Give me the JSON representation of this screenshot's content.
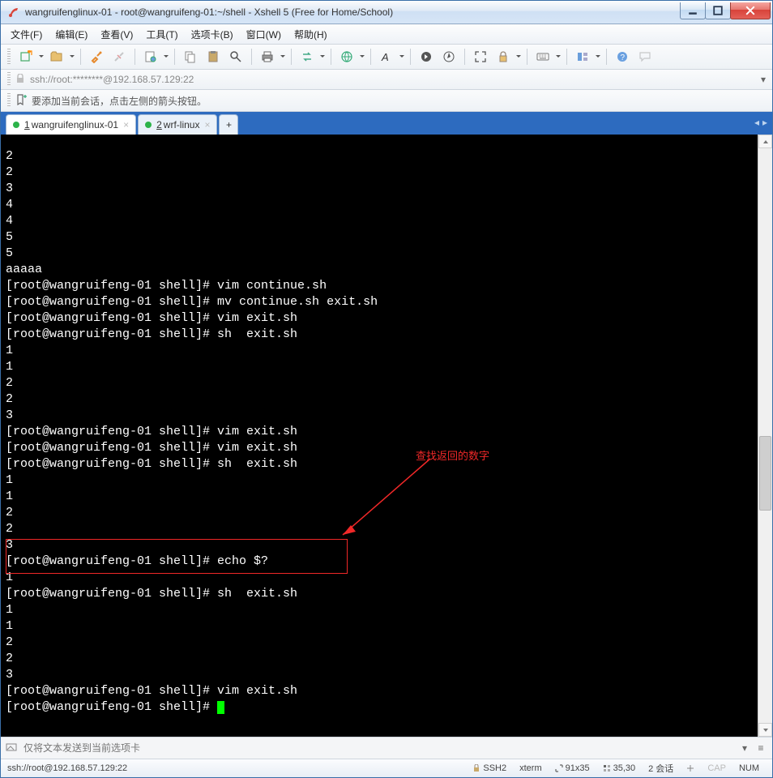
{
  "window_title": "wangruifenglinux-01 - root@wangruifeng-01:~/shell - Xshell 5 (Free for Home/School)",
  "menu": [
    "文件(F)",
    "编辑(E)",
    "查看(V)",
    "工具(T)",
    "选项卡(B)",
    "窗口(W)",
    "帮助(H)"
  ],
  "address": "ssh://root:********@192.168.57.129:22",
  "tip": "要添加当前会话，点击左侧的箭头按钮。",
  "tabs": [
    {
      "num": "1",
      "label": "wangruifenglinux-01",
      "dot": "#2db34a",
      "active": true
    },
    {
      "num": "2",
      "label": "wrf-linux",
      "dot": "#2db34a",
      "active": false
    }
  ],
  "terminal": {
    "lines": [
      "2",
      "2",
      "3",
      "4",
      "4",
      "5",
      "5",
      "aaaaa",
      "[root@wangruifeng-01 shell]# vim continue.sh",
      "[root@wangruifeng-01 shell]# mv continue.sh exit.sh",
      "[root@wangruifeng-01 shell]# vim exit.sh",
      "[root@wangruifeng-01 shell]# sh  exit.sh",
      "1",
      "1",
      "2",
      "2",
      "3",
      "[root@wangruifeng-01 shell]# vim exit.sh",
      "[root@wangruifeng-01 shell]# vim exit.sh",
      "[root@wangruifeng-01 shell]# sh  exit.sh",
      "1",
      "1",
      "2",
      "2",
      "3",
      "[root@wangruifeng-01 shell]# echo $?",
      "1",
      "[root@wangruifeng-01 shell]# sh  exit.sh",
      "1",
      "1",
      "2",
      "2",
      "3",
      "[root@wangruifeng-01 shell]# vim exit.sh",
      "[root@wangruifeng-01 shell]# "
    ],
    "annotation_label": "查找返回的数字"
  },
  "sendbar_placeholder": "仅将文本发送到当前选项卡",
  "status": {
    "left": "ssh://root@192.168.57.129:22",
    "ssh": "SSH2",
    "termtype": "xterm",
    "size": "91x35",
    "pos": "35,30",
    "sessions": "2 会话",
    "cap": "CAP",
    "num": "NUM"
  }
}
